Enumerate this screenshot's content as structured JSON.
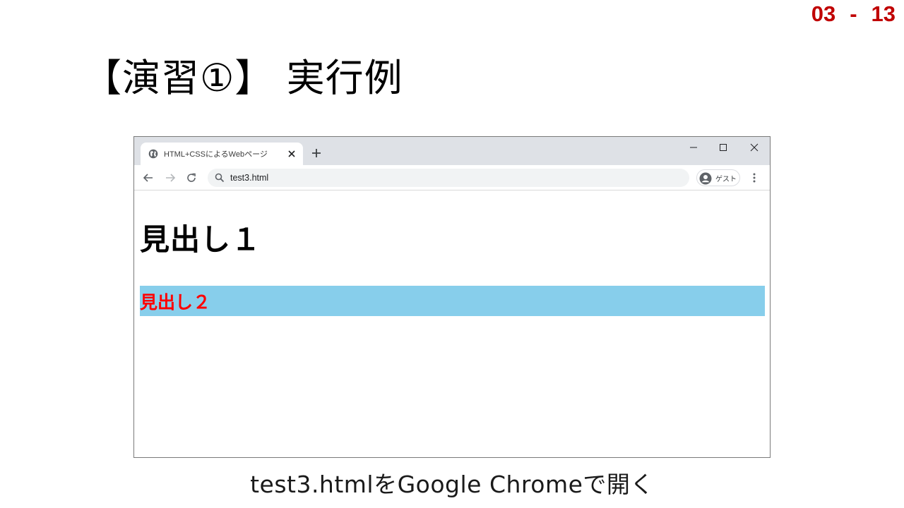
{
  "slide": {
    "number": "03",
    "separator": "-",
    "page": "13",
    "title": "【演習①】 実行例",
    "caption": "test3.htmlをGoogle Chromeで開く"
  },
  "browser": {
    "tab_title": "HTML+CSSによるWebページ",
    "url": "test3.html",
    "profile_label": "ゲスト"
  },
  "page": {
    "h1": "見出し１",
    "h2": "見出し２",
    "h2_background": "#87ceeb",
    "h2_color": "#ff0000"
  },
  "colors": {
    "slide_number": "#c00000",
    "tabstrip": "#dee1e6",
    "omnibox": "#f1f3f4"
  }
}
